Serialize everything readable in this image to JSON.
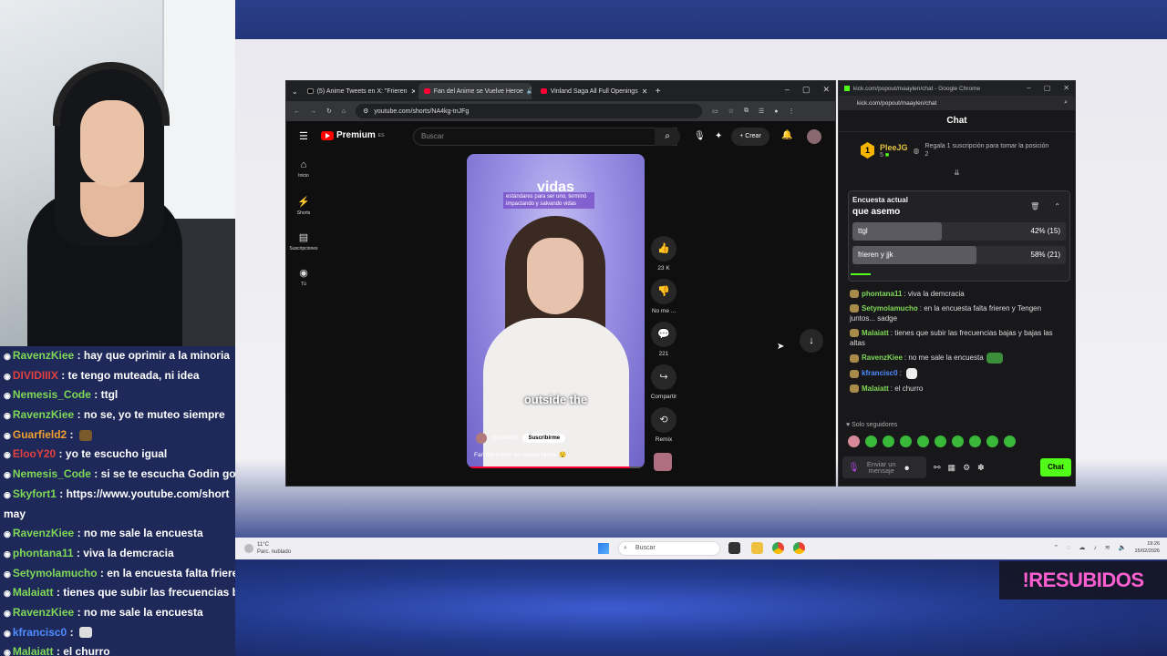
{
  "browser": {
    "tabs": [
      {
        "label": "(5) Anime Tweets en X: \"Frieren",
        "color": "#000000"
      },
      {
        "label": "Fan del Anime se Vuelve Heroe",
        "color": "#ff0033"
      },
      {
        "label": "Vinland Saga All Full Openings",
        "color": "#ff0033"
      }
    ],
    "url": "youtube.com/shorts/NA4kg-tnJFg"
  },
  "youtube": {
    "brand": "Premium",
    "brand_region": "ES",
    "search_placeholder": "Buscar",
    "create_label": "Crear",
    "nav": [
      {
        "label": "Inicio",
        "icon": "home-icon"
      },
      {
        "label": "Shorts",
        "icon": "shorts-icon"
      },
      {
        "label": "Suscripciones",
        "icon": "subscriptions-icon"
      },
      {
        "label": "Tú",
        "icon": "you-icon"
      }
    ],
    "short": {
      "overlay_big": "vidas",
      "overlay_caption": "estándares para ser uno, terminó impactando y salvando vidas",
      "subtitle": "outside the",
      "channel": "@lachelfys",
      "subscribe_label": "Suscribirme",
      "title": "Fan del Anime se Vuelve Heroe 😲"
    },
    "actions": [
      {
        "label": "23 K",
        "icon": "like-icon"
      },
      {
        "label": "No me ...",
        "icon": "dislike-icon"
      },
      {
        "label": "221",
        "icon": "comment-icon"
      },
      {
        "label": "Compartir",
        "icon": "share-icon"
      },
      {
        "label": "Remix",
        "icon": "remix-icon"
      }
    ]
  },
  "kick": {
    "window_title": "kick.com/popout/maaylen/chat - Google Chrome",
    "url": "kick.com/popout/maaylen/chat",
    "header": "Chat",
    "pinned": {
      "name": "PleeJG",
      "rank": "1",
      "count": "5",
      "message": "Regala 1 suscripción para tomar la posición 2"
    },
    "poll": {
      "heading": "Encuesta actual",
      "question": "que asemo",
      "options": [
        {
          "label": "ttgl",
          "result": "42% (15)",
          "fraction": 0.42
        },
        {
          "label": "frieren y jjk",
          "result": "58% (21)",
          "fraction": 0.58
        }
      ]
    },
    "messages": [
      {
        "user": "phontana11",
        "color": "#7fd957",
        "text": "viva la demcracia"
      },
      {
        "user": "Setymolamucho",
        "color": "#7fd957",
        "text": "en la encuesta falta frieren y Tengen juntos... sadge"
      },
      {
        "user": "Malaiatt",
        "color": "#7fd957",
        "text": "tienes que subir las frecuencias bajas y bajas las altas"
      },
      {
        "user": "RavenzKiee",
        "color": "#7fd957",
        "text": "no me sale la encuesta"
      },
      {
        "user": "kfrancisc0",
        "color": "#4f8cff",
        "text": ""
      },
      {
        "user": "Malaiatt",
        "color": "#7fd957",
        "text": "el churro"
      }
    ],
    "followers_only": "Solo seguidores",
    "input_placeholder": "Enviar un mensaje",
    "send_label": "Chat"
  },
  "stream_chat": [
    {
      "user": "RavenzKiee",
      "color": "#7fd957",
      "text": "hay que oprimir a la minoria"
    },
    {
      "user": "DIVIDIIIX",
      "color": "#e04040",
      "text": "te tengo muteada, ni idea"
    },
    {
      "user": "Nemesis_Code",
      "color": "#7fd957",
      "text": "ttgl"
    },
    {
      "user": "RavenzKiee",
      "color": "#7fd957",
      "text": "no se, yo te muteo siempre"
    },
    {
      "user": "Guarfield2",
      "color": "#f0a030",
      "text": ""
    },
    {
      "user": "ElooY20",
      "color": "#e04040",
      "text": "yo te escucho igual"
    },
    {
      "user": "Nemesis_Code",
      "color": "#7fd957",
      "text": "si se te escucha Godin godi"
    },
    {
      "user": "Skyfort1",
      "color": "#7fd957",
      "text": "https://www.youtube.com/short"
    },
    {
      "user": "",
      "color": "#ffffff",
      "text": "may"
    },
    {
      "user": "RavenzKiee",
      "color": "#7fd957",
      "text": "no me sale la encuesta"
    },
    {
      "user": "phontana11",
      "color": "#7fd957",
      "text": "viva la demcracia"
    },
    {
      "user": "Setymolamucho",
      "color": "#7fd957",
      "text": "en la encuesta falta frierer"
    },
    {
      "user": "Malaiatt",
      "color": "#7fd957",
      "text": "tienes que subir las frecuencias bajas"
    },
    {
      "user": "RavenzKiee",
      "color": "#7fd957",
      "text": "no me sale la encuesta"
    },
    {
      "user": "kfrancisc0",
      "color": "#4f8cff",
      "text": ""
    },
    {
      "user": "Malaiatt",
      "color": "#7fd957",
      "text": "el churro"
    }
  ],
  "taskbar": {
    "weather_temp": "11°C",
    "weather_desc": "Parc. nublado",
    "search_label": "Buscar",
    "time": "19:26",
    "date": "15/02/2026"
  },
  "overlay_badge": "!RESUBIDOS"
}
